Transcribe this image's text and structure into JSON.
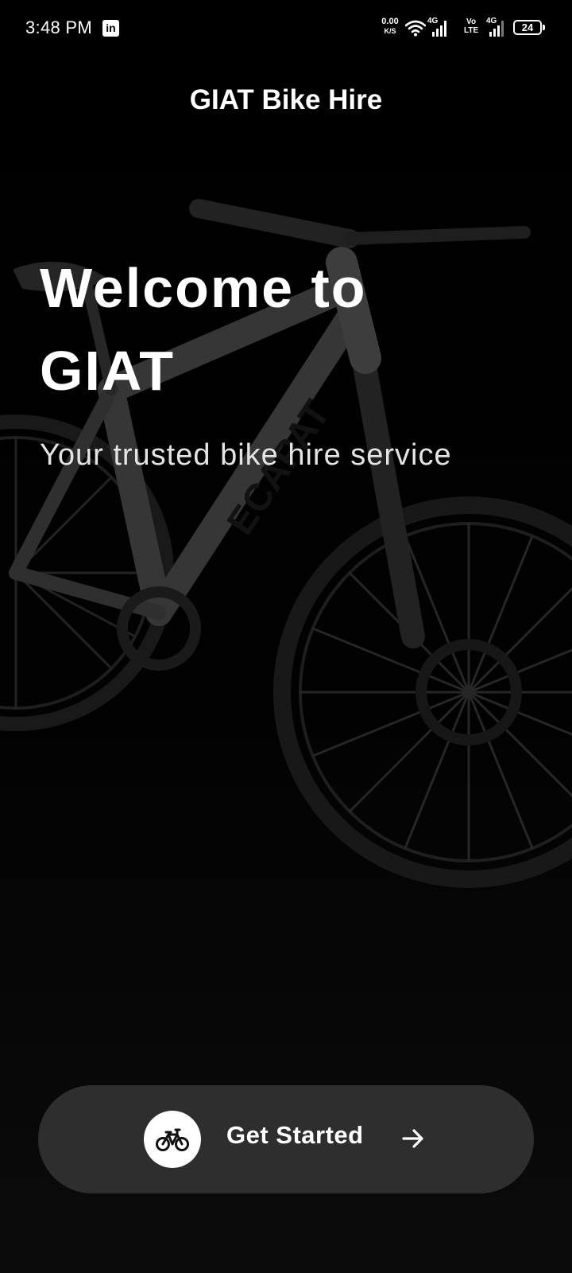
{
  "status_bar": {
    "time": "3:48 PM",
    "net_speed_value": "0.00",
    "net_speed_unit": "K/S",
    "sim1_label": "4G",
    "volte_line1": "Vo",
    "volte_line2": "LTE",
    "sim2_label": "4G",
    "battery_level": "24",
    "notification_icon": "linkedin-icon"
  },
  "app_bar": {
    "title": "GIAT Bike Hire"
  },
  "hero": {
    "heading_line1": "Welcome to",
    "heading_line2": "GIAT",
    "subtitle": "Your trusted bike hire service",
    "background": "bicycle-photo"
  },
  "cta": {
    "label": "Get Started",
    "leading_icon": "bike-icon",
    "trailing_icon": "arrow-right-icon"
  },
  "colors": {
    "background": "#050505",
    "button_bg": "#2e2e2e",
    "text": "#ffffff"
  }
}
